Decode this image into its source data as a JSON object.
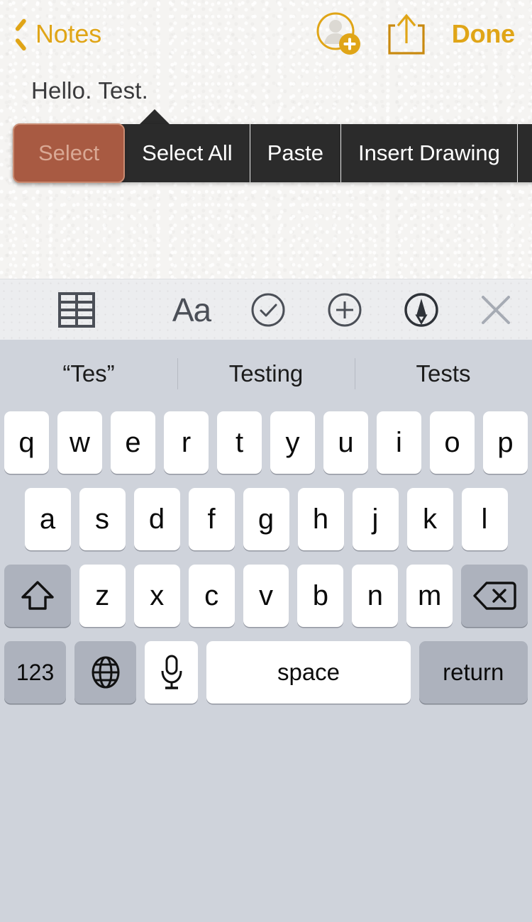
{
  "navbar": {
    "back_label": "Notes",
    "back_icon": "chevron-left-icon",
    "add_person_icon": "add-person-icon",
    "share_icon": "share-up-arrow-icon",
    "done_label": "Done",
    "accent_color": "#E0A517"
  },
  "note": {
    "body_text": "Hello. Test."
  },
  "context_menu": {
    "background_color": "#2B2B2B",
    "selected_color": "#A85A42",
    "items": [
      {
        "label": "Select",
        "selected": true
      },
      {
        "label": "Select All",
        "selected": false
      },
      {
        "label": "Paste",
        "selected": false
      },
      {
        "label": "Insert Drawing",
        "selected": false
      }
    ],
    "more_icon": "triangle-right-icon"
  },
  "keyboard_toolbar": {
    "background_color": "#ECEDEF",
    "items": [
      {
        "name": "table-icon",
        "label": "Table"
      },
      {
        "name": "text-format-icon",
        "label": "Aa"
      },
      {
        "name": "checklist-circle-icon",
        "label": "Checklist"
      },
      {
        "name": "add-circle-icon",
        "label": "Add"
      },
      {
        "name": "markup-pen-icon",
        "label": "Markup"
      },
      {
        "name": "close-icon",
        "label": "Dismiss Keyboard"
      }
    ]
  },
  "predictions": {
    "background_color": "#CFD3DB",
    "items": [
      "“Tes”",
      "Testing",
      "Tests"
    ]
  },
  "keyboard": {
    "background_color": "#CFD3DB",
    "key_color": "#FFFFFF",
    "modifier_key_color": "#ADB2BD",
    "row1": [
      "q",
      "w",
      "e",
      "r",
      "t",
      "y",
      "u",
      "i",
      "o",
      "p"
    ],
    "row2": [
      "a",
      "s",
      "d",
      "f",
      "g",
      "h",
      "j",
      "k",
      "l"
    ],
    "row3": [
      "z",
      "x",
      "c",
      "v",
      "b",
      "n",
      "m"
    ],
    "shift_icon": "shift-up-arrow-icon",
    "backspace_icon": "backspace-delete-icon",
    "numbers_label": "123",
    "globe_icon": "globe-icon",
    "mic_icon": "microphone-icon",
    "space_label": "space",
    "return_label": "return"
  }
}
